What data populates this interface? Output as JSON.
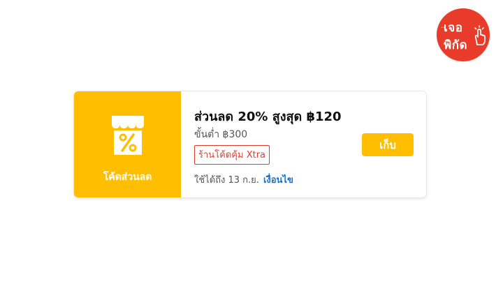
{
  "badge": {
    "line1": "เจอ",
    "line2": "พิกัด",
    "dots": "..",
    "icon": "tap-hand-icon"
  },
  "coupon": {
    "stub": {
      "icon": "shop-percent-icon",
      "label": "โค้ดส่วนลด"
    },
    "title": "ส่วนลด 20% สูงสุด ฿120",
    "min_spend": "ขั้นต่ำ ฿300",
    "tag": "ร้านโค้ดคุ้ม Xtra",
    "validity": "ใช้ได้ถึง 13 ก.ย.",
    "conditions_link": "เงื่อนไข",
    "claim_button": "เก็บ"
  },
  "colors": {
    "accent": "#ffbf00",
    "tag_red": "#e23b2a",
    "link_blue": "#1a6fd0",
    "badge_red": "#e83b2a"
  }
}
